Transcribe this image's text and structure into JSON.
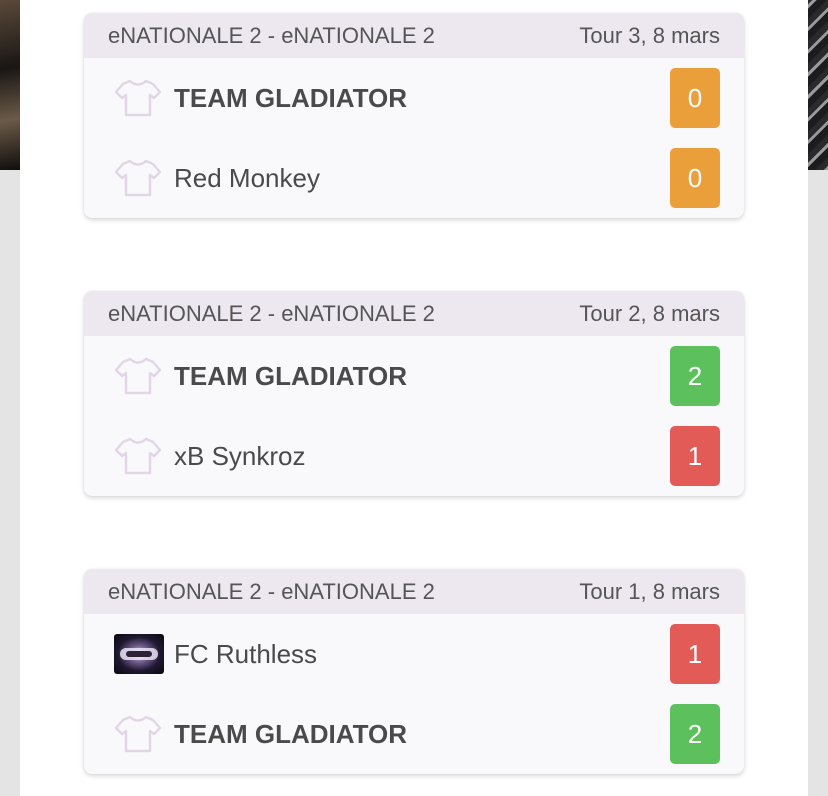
{
  "colors": {
    "win": "#5cc15c",
    "loss": "#e25b57",
    "draw": "#ea9f3b",
    "header_bg": "#ede8f0",
    "jersey": "#e2d6e6"
  },
  "matches": [
    {
      "competition": "eNATIONALE 2 - eNATIONALE 2",
      "round": "Tour 3, 8 mars",
      "home": {
        "name": "TEAM GLADIATOR",
        "score": "0",
        "bold": true,
        "icon": "jersey-icon",
        "result": "draw"
      },
      "away": {
        "name": "Red Monkey",
        "score": "0",
        "bold": false,
        "icon": "jersey-icon",
        "result": "draw"
      }
    },
    {
      "competition": "eNATIONALE 2 - eNATIONALE 2",
      "round": "Tour 2, 8 mars",
      "home": {
        "name": "TEAM GLADIATOR",
        "score": "2",
        "bold": true,
        "icon": "jersey-icon",
        "result": "win"
      },
      "away": {
        "name": "xB Synkroz",
        "score": "1",
        "bold": false,
        "icon": "jersey-icon",
        "result": "loss"
      }
    },
    {
      "competition": "eNATIONALE 2 - eNATIONALE 2",
      "round": "Tour 1, 8 mars",
      "home": {
        "name": "FC Ruthless",
        "score": "1",
        "bold": false,
        "icon": "team-logo",
        "result": "loss"
      },
      "away": {
        "name": "TEAM GLADIATOR",
        "score": "2",
        "bold": true,
        "icon": "jersey-icon",
        "result": "win"
      }
    }
  ]
}
